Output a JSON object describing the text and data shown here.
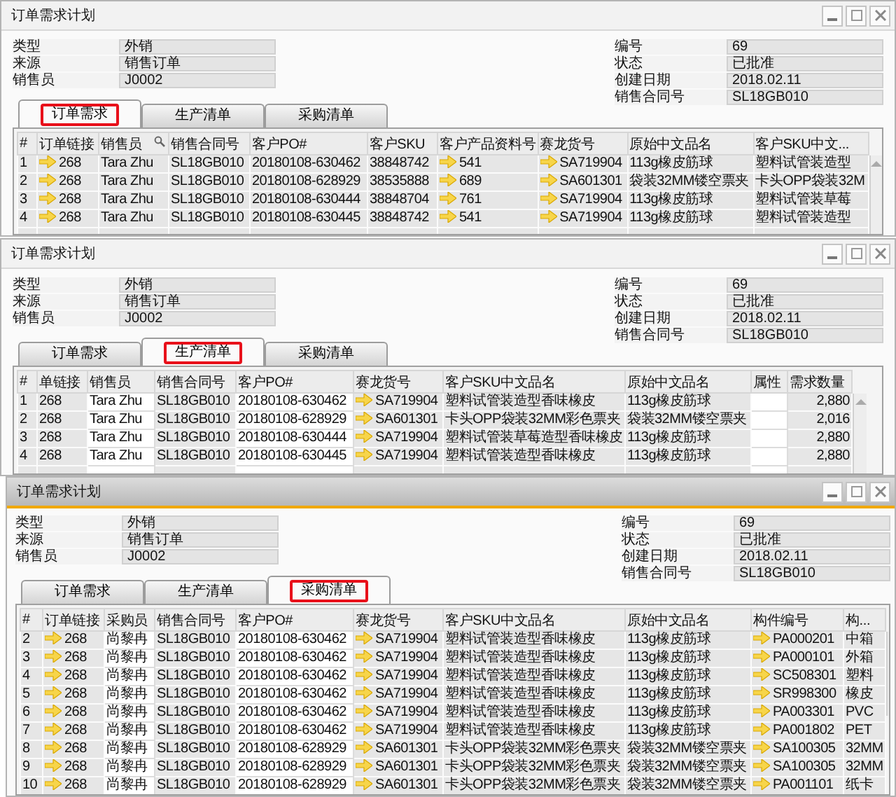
{
  "windows": [
    {
      "title": "订单需求计划",
      "active": false,
      "fields_left": [
        {
          "label": "类型",
          "value": "外销"
        },
        {
          "label": "来源",
          "value": "销售订单"
        },
        {
          "label": "销售员",
          "value": "J0002"
        }
      ],
      "fields_right": [
        {
          "label": "编号",
          "value": "69"
        },
        {
          "label": "状态",
          "value": "已批准"
        },
        {
          "label": "创建日期",
          "value": "2018.02.11"
        },
        {
          "label": "销售合同号",
          "value": "SL18GB010"
        }
      ],
      "tabs": [
        {
          "label": "订单需求",
          "selected": true,
          "highlighted": true
        },
        {
          "label": "生产清单",
          "selected": false,
          "highlighted": false
        },
        {
          "label": "采购清单",
          "selected": false,
          "highlighted": false
        }
      ],
      "table": {
        "columns": [
          {
            "label": "#"
          },
          {
            "label": "订单链接",
            "link": true
          },
          {
            "label": "销售员",
            "search": true
          },
          {
            "label": "销售合同号"
          },
          {
            "label": "客户PO#"
          },
          {
            "label": "客户SKU"
          },
          {
            "label": "客户产品资料号",
            "link": true
          },
          {
            "label": "赛龙货号",
            "link": true
          },
          {
            "label": "原始中文品名"
          },
          {
            "label": "客户SKU中文..."
          }
        ],
        "rows": [
          [
            "1",
            "268",
            "Tara Zhu",
            "SL18GB010",
            "20180108-630462",
            "38848742",
            "541",
            "SA719904",
            "113g橡皮筋球",
            "塑料试管装造型"
          ],
          [
            "2",
            "268",
            "Tara Zhu",
            "SL18GB010",
            "20180108-628929",
            "38535888",
            "689",
            "SA601301",
            "袋装32MM镂空票夹",
            "卡头OPP袋装32M"
          ],
          [
            "3",
            "268",
            "Tara Zhu",
            "SL18GB010",
            "20180108-630444",
            "38848704",
            "761",
            "SA719904",
            "113g橡皮筋球",
            "塑料试管装草莓"
          ],
          [
            "4",
            "268",
            "Tara Zhu",
            "SL18GB010",
            "20180108-630445",
            "38848742",
            "541",
            "SA719904",
            "113g橡皮筋球",
            "塑料试管装造型"
          ]
        ]
      }
    },
    {
      "title": "订单需求计划",
      "active": false,
      "fields_left": [
        {
          "label": "类型",
          "value": "外销"
        },
        {
          "label": "来源",
          "value": "销售订单"
        },
        {
          "label": "销售员",
          "value": "J0002"
        }
      ],
      "fields_right": [
        {
          "label": "编号",
          "value": "69"
        },
        {
          "label": "状态",
          "value": "已批准"
        },
        {
          "label": "创建日期",
          "value": "2018.02.11"
        },
        {
          "label": "销售合同号",
          "value": "SL18GB010"
        }
      ],
      "tabs": [
        {
          "label": "订单需求",
          "selected": false,
          "highlighted": false
        },
        {
          "label": "生产清单",
          "selected": true,
          "highlighted": true
        },
        {
          "label": "采购清单",
          "selected": false,
          "highlighted": false
        }
      ],
      "table": {
        "columns": [
          {
            "label": "#"
          },
          {
            "label": "单链接"
          },
          {
            "label": "销售员",
            "editable": true
          },
          {
            "label": "销售合同号"
          },
          {
            "label": "客户PO#",
            "editable": true
          },
          {
            "label": "赛龙货号",
            "link": true
          },
          {
            "label": "客户SKU中文品名"
          },
          {
            "label": "原始中文品名"
          },
          {
            "label": "属性",
            "editable": true
          },
          {
            "label": "需求数量",
            "numeric": true
          }
        ],
        "rows": [
          [
            "1",
            "268",
            "Tara Zhu",
            "SL18GB010",
            "20180108-630462",
            "SA719904",
            "塑料试管装造型香味橡皮",
            "113g橡皮筋球",
            "",
            "2,880"
          ],
          [
            "2",
            "268",
            "Tara Zhu",
            "SL18GB010",
            "20180108-628929",
            "SA601301",
            "卡头OPP袋装32MM彩色票夹",
            "袋装32MM镂空票夹",
            "",
            "2,016"
          ],
          [
            "3",
            "268",
            "Tara Zhu",
            "SL18GB010",
            "20180108-630444",
            "SA719904",
            "塑料试管装草莓造型香味橡皮",
            "113g橡皮筋球",
            "",
            "2,880"
          ],
          [
            "4",
            "268",
            "Tara Zhu",
            "SL18GB010",
            "20180108-630445",
            "SA719904",
            "塑料试管装造型香味橡皮",
            "113g橡皮筋球",
            "",
            "2,880"
          ]
        ]
      }
    },
    {
      "title": "订单需求计划",
      "active": true,
      "fields_left": [
        {
          "label": "类型",
          "value": "外销"
        },
        {
          "label": "来源",
          "value": "销售订单"
        },
        {
          "label": "销售员",
          "value": "J0002"
        }
      ],
      "fields_right": [
        {
          "label": "编号",
          "value": "69"
        },
        {
          "label": "状态",
          "value": "已批准"
        },
        {
          "label": "创建日期",
          "value": "2018.02.11"
        },
        {
          "label": "销售合同号",
          "value": "SL18GB010"
        }
      ],
      "tabs": [
        {
          "label": "订单需求",
          "selected": false,
          "highlighted": false
        },
        {
          "label": "生产清单",
          "selected": false,
          "highlighted": false
        },
        {
          "label": "采购清单",
          "selected": true,
          "highlighted": true
        }
      ],
      "table": {
        "columns": [
          {
            "label": "#"
          },
          {
            "label": "订单链接",
            "link": true
          },
          {
            "label": "采购员",
            "editable": true
          },
          {
            "label": "销售合同号"
          },
          {
            "label": "客户PO#",
            "editable": true
          },
          {
            "label": "赛龙货号",
            "link": true
          },
          {
            "label": "客户SKU中文品名"
          },
          {
            "label": "原始中文品名"
          },
          {
            "label": "构件编号",
            "link": true
          },
          {
            "label": "构..."
          }
        ],
        "rows": [
          [
            "2",
            "268",
            "尚黎冉",
            "SL18GB010",
            "20180108-630462",
            "SA719904",
            "塑料试管装造型香味橡皮",
            "113g橡皮筋球",
            "PA000201",
            "中箱"
          ],
          [
            "3",
            "268",
            "尚黎冉",
            "SL18GB010",
            "20180108-630462",
            "SA719904",
            "塑料试管装造型香味橡皮",
            "113g橡皮筋球",
            "PA000101",
            "外箱"
          ],
          [
            "4",
            "268",
            "尚黎冉",
            "SL18GB010",
            "20180108-630462",
            "SA719904",
            "塑料试管装造型香味橡皮",
            "113g橡皮筋球",
            "SC508301",
            "塑料"
          ],
          [
            "5",
            "268",
            "尚黎冉",
            "SL18GB010",
            "20180108-630462",
            "SA719904",
            "塑料试管装造型香味橡皮",
            "113g橡皮筋球",
            "SR998300",
            "橡皮"
          ],
          [
            "6",
            "268",
            "尚黎冉",
            "SL18GB010",
            "20180108-630462",
            "SA719904",
            "塑料试管装造型香味橡皮",
            "113g橡皮筋球",
            "PA003301",
            "PVC"
          ],
          [
            "7",
            "268",
            "尚黎冉",
            "SL18GB010",
            "20180108-630462",
            "SA719904",
            "塑料试管装造型香味橡皮",
            "113g橡皮筋球",
            "PA001802",
            "PET"
          ],
          [
            "8",
            "268",
            "尚黎冉",
            "SL18GB010",
            "20180108-628929",
            "SA601301",
            "卡头OPP袋装32MM彩色票夹",
            "袋装32MM镂空票夹",
            "SA100305",
            "32MM"
          ],
          [
            "9",
            "268",
            "尚黎冉",
            "SL18GB010",
            "20180108-628929",
            "SA601301",
            "卡头OPP袋装32MM彩色票夹",
            "袋装32MM镂空票夹",
            "SA100305",
            "32MM"
          ],
          [
            "10",
            "268",
            "尚黎冉",
            "SL18GB010",
            "20180108-628929",
            "SA601301",
            "卡头OPP袋装32MM彩色票夹",
            "袋装32MM镂空票夹",
            "PA001101",
            "纸卡"
          ]
        ]
      }
    }
  ]
}
